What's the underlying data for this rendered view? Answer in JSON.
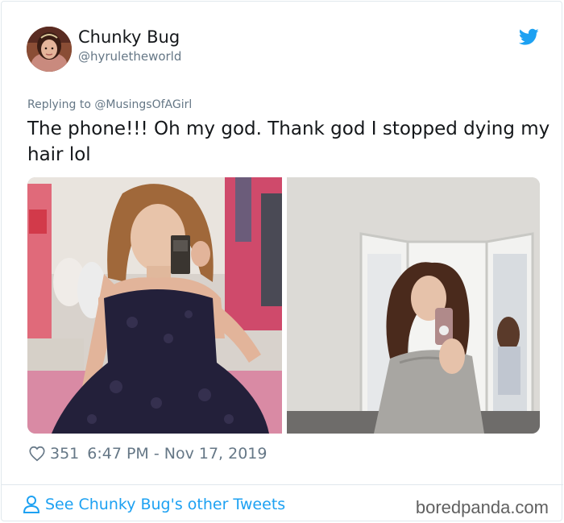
{
  "author": {
    "display_name": "Chunky Bug",
    "handle": "@hyruletheworld",
    "avatar_icon": "profile-photo"
  },
  "reply": {
    "text": "Replying to @MusingsOfAGirl"
  },
  "tweet": {
    "text": "The phone!!! Oh my god. Thank god I stopped dying my hair lol"
  },
  "meta": {
    "likes": "351",
    "timestamp": "6:47 PM - Nov 17, 2019"
  },
  "footer": {
    "link_label": "See Chunky Bug's other Tweets",
    "watermark": "boredpanda.com"
  },
  "colors": {
    "twitter_blue": "#1da1f2",
    "text_primary": "#14171a",
    "text_secondary": "#657786",
    "border": "#e1e8ed"
  }
}
